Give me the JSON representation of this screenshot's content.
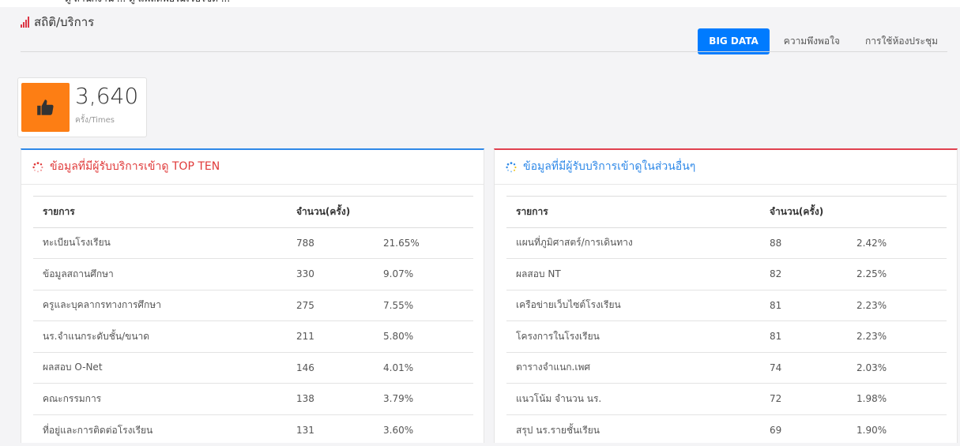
{
  "top_strip": {
    "text": "ดู สำนักงาน ... ดู แพลตฟอร์มเว็บไซต์ ..."
  },
  "header": {
    "title": "สถิติ/บริการ",
    "nav": [
      {
        "label": "BIG DATA",
        "active": true
      },
      {
        "label": "ความพึงพอใจ",
        "active": false
      },
      {
        "label": "การใช้ห้องประชุม",
        "active": false
      }
    ]
  },
  "stat": {
    "value": "3,640",
    "unit": "ครั้ง/Times",
    "icon": "thumbs-up-icon"
  },
  "left_card": {
    "title": "ข้อมูลที่มีผู้รับบริการเข้าดู TOP TEN",
    "headers": [
      "รายการ",
      "จำนวน(ครั้ง)",
      ""
    ],
    "rows": [
      [
        "ทะเบียนโรงเรียน",
        "788",
        "21.65%"
      ],
      [
        "ข้อมูลสถานศึกษา",
        "330",
        "9.07%"
      ],
      [
        "ครูและบุคลากรทางการศึกษา",
        "275",
        "7.55%"
      ],
      [
        "นร.จำแนกระดับชั้น/ขนาด",
        "211",
        "5.80%"
      ],
      [
        "ผลสอบ O-Net",
        "146",
        "4.01%"
      ],
      [
        "คณะกรรมการ",
        "138",
        "3.79%"
      ],
      [
        "ที่อยู่และการติดต่อโรงเรียน",
        "131",
        "3.60%"
      ]
    ]
  },
  "right_card": {
    "title": "ข้อมูลที่มีผู้รับบริการเข้าดูในส่วนอื่นๆ",
    "headers": [
      "รายการ",
      "จำนวน(ครั้ง)",
      ""
    ],
    "rows": [
      [
        "แผนที่ภูมิศาสตร์/การเดินทาง",
        "88",
        "2.42%"
      ],
      [
        "ผลสอบ NT",
        "82",
        "2.25%"
      ],
      [
        "เครือข่ายเว็บไซต์โรงเรียน",
        "81",
        "2.23%"
      ],
      [
        "โครงการในโรงเรียน",
        "81",
        "2.23%"
      ],
      [
        "ตารางจำแนก.เพศ",
        "74",
        "2.03%"
      ],
      [
        "แนวโน้ม จำนวน นร.",
        "72",
        "1.98%"
      ],
      [
        "สรุป นร.รายชั้นเรียน",
        "69",
        "1.90%"
      ]
    ]
  },
  "colors": {
    "accent_blue": "#007bff",
    "orange": "#fd7e14",
    "red": "#dc3545",
    "title_red": "#e03a3a",
    "title_blue": "#2f89e8"
  }
}
